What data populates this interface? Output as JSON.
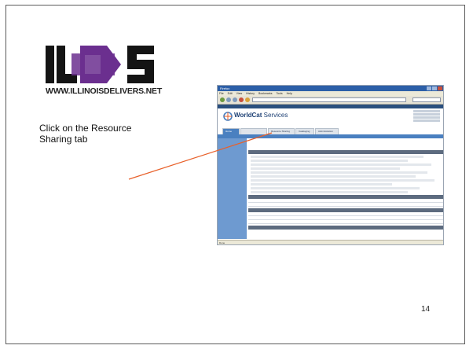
{
  "slide": {
    "logo_text": "ILDS",
    "logo_url": "WWW.ILLINOISDELIVERS.NET",
    "instruction": "Click on the Resource Sharing tab",
    "page_number": "14"
  },
  "browser": {
    "title": "Firefox",
    "address": "",
    "menu": [
      "File",
      "Edit",
      "View",
      "History",
      "Bookmarks",
      "Tools",
      "Help"
    ],
    "status": "Done"
  },
  "worldcat": {
    "brand": "WorldCat",
    "brand_suffix": "Services",
    "tabs": [
      "Home",
      "",
      "Resource Sharing",
      "Cataloging",
      "Administration"
    ],
    "active_tab": 0
  },
  "colors": {
    "logo_purple": "#6b2f8f",
    "logo_black": "#141414",
    "pointer_line": "#e8602a",
    "tab_blue": "#4a80c0"
  }
}
